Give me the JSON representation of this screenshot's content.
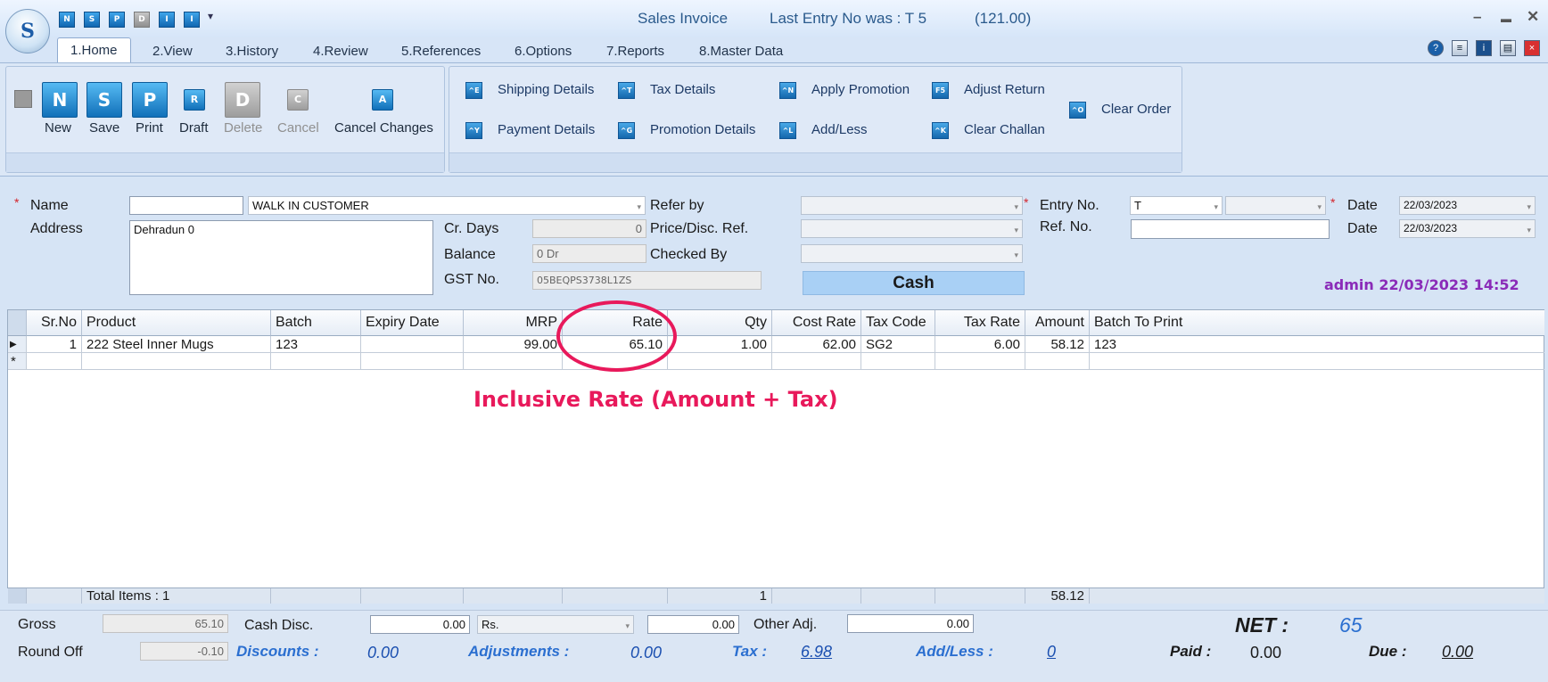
{
  "header": {
    "title": "Sales Invoice",
    "last_entry": "Last Entry No was : T 5",
    "last_amount": "(121.00)",
    "logo_letter": "S",
    "quick_access": [
      "N",
      "S",
      "P",
      "D",
      "I",
      "I"
    ],
    "win_minimize": "–",
    "win_restore": "▬",
    "win_close": "✕"
  },
  "tabs": [
    "1.Home",
    "2.View",
    "3.History",
    "4.Review",
    "5.References",
    "6.Options",
    "7.Reports",
    "8.Master Data"
  ],
  "ribbon": {
    "buttons": [
      {
        "label": "New",
        "icon": "N"
      },
      {
        "label": "Save",
        "icon": "S"
      },
      {
        "label": "Print",
        "icon": "P"
      },
      {
        "label": "Draft",
        "icon": "R"
      },
      {
        "label": "Delete",
        "icon": "D"
      },
      {
        "label": "Cancel",
        "icon": "C"
      },
      {
        "label": "Cancel Changes",
        "icon": "A"
      }
    ],
    "links": [
      {
        "label": "Shipping Details",
        "icon": "^E"
      },
      {
        "label": "Tax Details",
        "icon": "^T"
      },
      {
        "label": "Apply Promotion",
        "icon": "^N"
      },
      {
        "label": "Adjust Return",
        "icon": "F5"
      },
      {
        "label": "Payment Details",
        "icon": "^Y"
      },
      {
        "label": "Promotion Details",
        "icon": "^G"
      },
      {
        "label": "Add/Less",
        "icon": "^L"
      },
      {
        "label": "Clear Challan",
        "icon": "^K"
      },
      {
        "label": "Clear Order",
        "icon": "^O"
      }
    ]
  },
  "form": {
    "name_label": "Name",
    "name_code": "",
    "name_value": "WALK IN CUSTOMER",
    "address_label": "Address",
    "address_value": "Dehradun 0",
    "cr_days_label": "Cr. Days",
    "cr_days_value": "0",
    "balance_label": "Balance",
    "balance_value": "0 Dr",
    "gst_label": "GST No.",
    "gst_value": "05BEQPS3738L1ZS",
    "refer_by_label": "Refer by",
    "price_disc_label": "Price/Disc. Ref.",
    "checked_by_label": "Checked By",
    "cash_label": "Cash",
    "entry_no_label": "Entry No.",
    "entry_no_value": "T",
    "ref_no_label": "Ref. No.",
    "date_label": "Date",
    "date_value": "22/03/2023",
    "date2_label": "Date",
    "date2_value": "22/03/2023",
    "user_stamp": "admin 22/03/2023 14:52",
    "required_mark": "*"
  },
  "grid": {
    "columns": [
      "Sr.No",
      "Product",
      "Batch",
      "Expiry Date",
      "MRP",
      "Rate",
      "Qty",
      "Cost Rate",
      "Tax Code",
      "Tax Rate",
      "Amount",
      "Batch To Print"
    ],
    "rows": [
      {
        "sr": "1",
        "product": "222 Steel Inner Mugs",
        "batch": "123",
        "expiry": "",
        "mrp": "99.00",
        "rate": "65.10",
        "qty": "1.00",
        "cost_rate": "62.00",
        "tax_code": "SG2",
        "tax_rate": "6.00",
        "amount": "58.12",
        "batch_print": "123"
      }
    ],
    "new_row_marker": "*",
    "current_row_marker": "▶",
    "totals": {
      "label": "Total Items : 1",
      "qty": "1",
      "amount": "58.12"
    }
  },
  "annotation": {
    "text": "Inclusive Rate (Amount + Tax)",
    "color": "#e8195b"
  },
  "footer": {
    "gross_label": "Gross",
    "gross_value": "65.10",
    "roundoff_label": "Round Off",
    "roundoff_value": "-0.10",
    "cash_disc_label": "Cash Disc.",
    "cash_disc_value": "0.00",
    "cash_disc_unit": "Rs.",
    "cash_disc_amount": "0.00",
    "other_adj_label": "Other Adj.",
    "other_adj_value": "0.00",
    "net_label": "NET :",
    "net_value": "65",
    "discounts_label": "Discounts :",
    "discounts_value": "0.00",
    "adjustments_label": "Adjustments :",
    "adjustments_value": "0.00",
    "tax_label": "Tax :",
    "tax_value": "6.98",
    "addless_label": "Add/Less :",
    "addless_value": "0",
    "paid_label": "Paid :",
    "paid_value": "0.00",
    "due_label": "Due :",
    "due_value": "0.00"
  },
  "colors": {
    "accent": "#1170b9",
    "annotation": "#e8195b",
    "user_stamp": "#8a2bb8",
    "cash_bg": "#a9d0f5"
  }
}
